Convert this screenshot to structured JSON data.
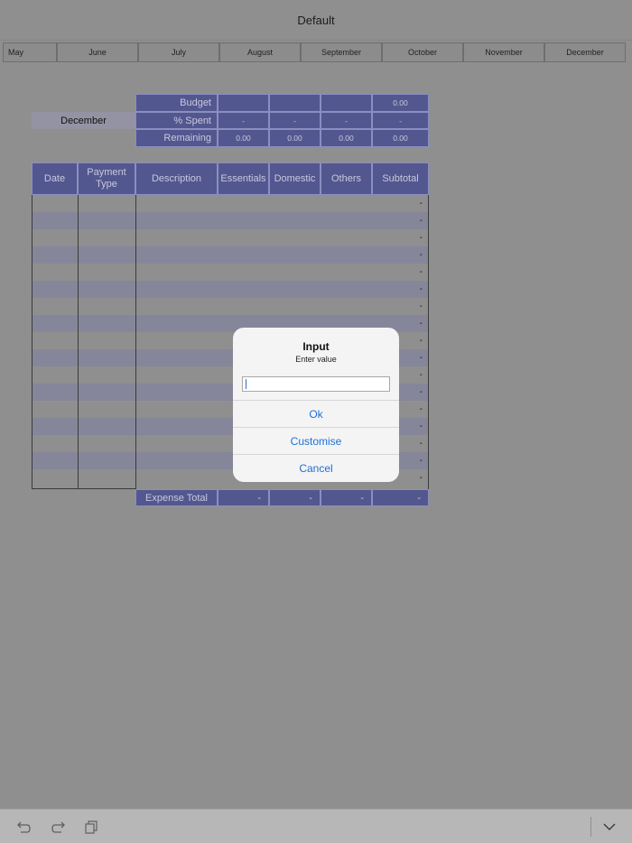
{
  "app": {
    "title": "Default"
  },
  "months": [
    "May",
    "June",
    "July",
    "August",
    "September",
    "October",
    "November",
    "December"
  ],
  "selected_month": "December",
  "summary": {
    "budget_label": "Budget",
    "spent_label": "% Spent",
    "remaining_label": "Remaining",
    "budget": [
      "",
      "",
      "",
      "0.00"
    ],
    "spent": [
      "-",
      "-",
      "-",
      "-"
    ],
    "remaining": [
      "0.00",
      "0.00",
      "0.00",
      "0.00"
    ]
  },
  "table": {
    "headers": [
      "Date",
      "Payment Type",
      "Description",
      "Essentials",
      "Domestic",
      "Others",
      "Subtotal"
    ],
    "subtotal_placeholder": "-",
    "total_label": "Expense Total",
    "totals": [
      "-",
      "-",
      "-",
      "-"
    ]
  },
  "dialog": {
    "title": "Input",
    "message": "Enter value",
    "input_value": "",
    "buttons": [
      "Ok",
      "Customise",
      "Cancel"
    ]
  },
  "toolbar": {
    "icons": [
      "undo-icon",
      "redo-icon",
      "copy-icon",
      "chevron-down-icon"
    ]
  },
  "colors": {
    "header_blue": "#53578f",
    "stripe": "#86869a",
    "overlay_gray": "#8f8f8f",
    "dialog_button": "#1c6fd8"
  }
}
